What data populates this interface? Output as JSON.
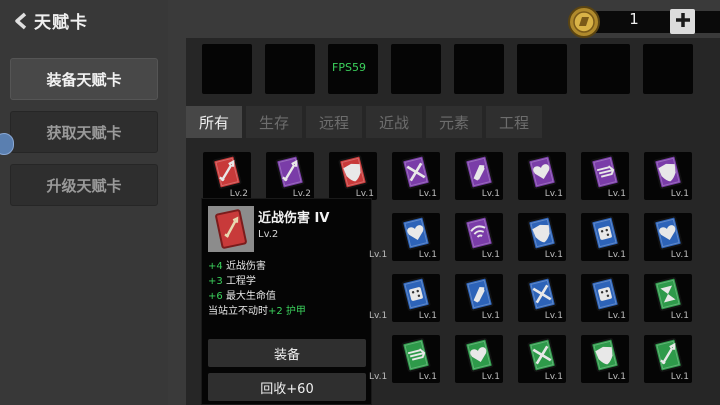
{
  "header": {
    "title": "天赋卡"
  },
  "currency": {
    "count": "1",
    "plus_label": "+"
  },
  "sidebar": {
    "items": [
      {
        "label": "装备天赋卡",
        "active": true
      },
      {
        "label": "获取天赋卡",
        "active": false
      },
      {
        "label": "升级天赋卡",
        "active": false
      }
    ]
  },
  "equip_slots": {
    "count": 8,
    "fps_text": "FPS59"
  },
  "filter_tabs": [
    "所有",
    "生存",
    "远程",
    "近战",
    "元素",
    "工程"
  ],
  "colors": {
    "red": "#c83a3a",
    "purple": "#7a3ca8",
    "blue": "#2d63b8",
    "green": "#2e9a4a",
    "gold": "#d9a830",
    "accent_green": "#3bd15c"
  },
  "cards": [
    [
      {
        "color": "red",
        "icon": "sword-icon",
        "level": "Lv.2"
      },
      {
        "color": "purple",
        "icon": "sword-icon",
        "level": "Lv.2"
      },
      {
        "color": "red",
        "icon": "shield-icon",
        "level": "Lv.1"
      },
      {
        "color": "purple",
        "icon": "cross-icon",
        "level": "Lv.1"
      },
      {
        "color": "purple",
        "icon": "bullet-icon",
        "level": "Lv.1"
      },
      {
        "color": "purple",
        "icon": "heart-icon",
        "level": "Lv.1"
      },
      {
        "color": "purple",
        "icon": "speed-icon",
        "level": "Lv.1"
      },
      {
        "color": "purple",
        "icon": "shield-icon",
        "level": "Lv.1"
      }
    ],
    [
      null,
      null,
      null,
      {
        "color": "blue",
        "icon": "heart-icon",
        "level": "Lv.1"
      },
      {
        "color": "purple",
        "icon": "wifi-icon",
        "level": "Lv.1"
      },
      {
        "color": "blue",
        "icon": "shield-icon",
        "level": "Lv.1"
      },
      {
        "color": "blue",
        "icon": "dice-icon",
        "level": "Lv.1"
      },
      {
        "color": "blue",
        "icon": "heart-icon",
        "level": "Lv.1"
      }
    ],
    [
      null,
      null,
      null,
      {
        "color": "blue",
        "icon": "dice-icon",
        "level": "Lv.1"
      },
      {
        "color": "blue",
        "icon": "bullet-icon",
        "level": "Lv.1"
      },
      {
        "color": "blue",
        "icon": "cross-icon",
        "level": "Lv.1"
      },
      {
        "color": "blue",
        "icon": "dice-icon",
        "level": "Lv.1"
      },
      {
        "color": "green",
        "icon": "hourglass-icon",
        "level": "Lv.1"
      }
    ],
    [
      null,
      null,
      null,
      {
        "color": "green",
        "icon": "speed-icon",
        "level": "Lv.1"
      },
      {
        "color": "green",
        "icon": "heart-icon",
        "level": "Lv.1"
      },
      {
        "color": "green",
        "icon": "cross-icon",
        "level": "Lv.1"
      },
      {
        "color": "green",
        "icon": "shield-icon",
        "level": "Lv.1"
      },
      {
        "color": "green",
        "icon": "sword-icon",
        "level": "Lv.1"
      }
    ]
  ],
  "hidden_levels": [
    "Lv.1",
    "Lv.1",
    "Lv.1"
  ],
  "popup": {
    "name": "近战伤害 IV",
    "level": "Lv.2",
    "stats": [
      {
        "value": "+4",
        "label": "近战伤害"
      },
      {
        "value": "+3",
        "label": "工程学"
      },
      {
        "value": "+6",
        "label": "最大生命值"
      }
    ],
    "condition_text": "当站立不动时",
    "condition_value": "+2 护甲",
    "equip_label": "装备",
    "recycle_label": "回收+60"
  }
}
